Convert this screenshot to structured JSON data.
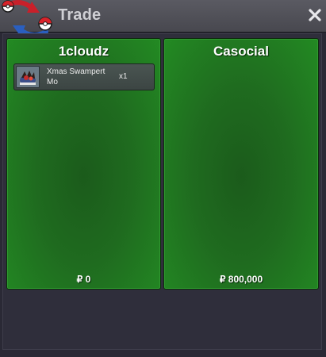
{
  "window": {
    "title": "Trade",
    "close_icon": "close-icon",
    "logo_icon": "trade-logo-icon"
  },
  "left_panel": {
    "player": "1cloudz",
    "items": [
      {
        "name": "Xmas Swampert Mo",
        "quantity": "x1",
        "icon": "xmas-swampert-icon"
      }
    ],
    "money": "₽ 0"
  },
  "right_panel": {
    "player": "Casocial",
    "items": [],
    "money": "₽ 800,000"
  },
  "colors": {
    "panel_green": "#238a23",
    "panel_green_dark": "#1b5b1b",
    "background": "#2a2935",
    "titlebar": "#4d4d54"
  }
}
